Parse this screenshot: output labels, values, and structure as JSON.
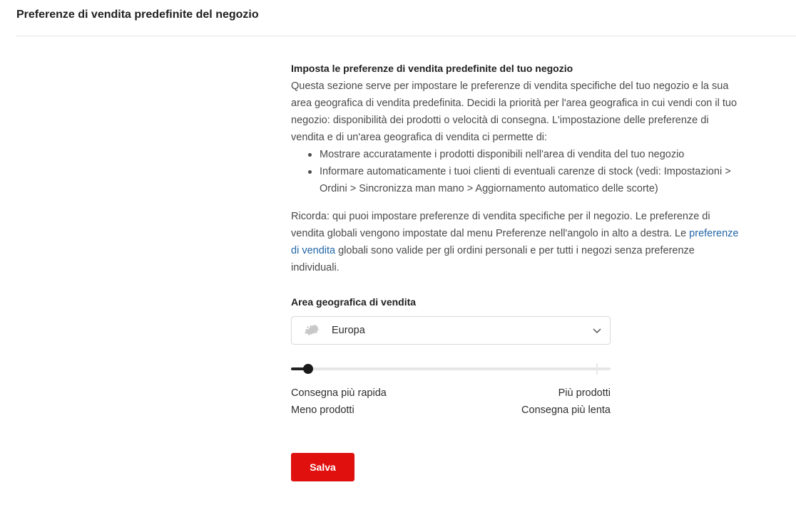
{
  "header": {
    "title": "Preferenze di vendita predefinite del negozio"
  },
  "intro": {
    "heading": "Imposta le preferenze di vendita predefinite del tuo negozio",
    "paragraph": "Questa sezione serve per impostare le preferenze di vendita specifiche del tuo negozio e la sua area geografica di vendita predefinita. Decidi la priorità per l'area geografica in cui vendi con il tuo negozio: disponibilità dei prodotti o velocità di consegna. L'impostazione delle preferenze di vendita e di un'area geografica di vendita ci permette di:",
    "bullets": [
      "Mostrare accuratamente i prodotti disponibili nell'area di vendita del tuo negozio",
      "Informare automaticamente i tuoi clienti di eventuali carenze di stock (vedi: Impostazioni > Ordini > Sincronizza man mano > Aggiornamento automatico delle scorte)"
    ],
    "reminder_before": "Ricorda: qui puoi impostare preferenze di vendita specifiche per il negozio. Le preferenze di vendita globali vengono impostate dal menu Preferenze nell'angolo in alto a destra. Le ",
    "reminder_link": "preferenze di vendita",
    "reminder_after": " globali sono valide per gli ordini personali e per tutti i negozi senza preferenze individuali."
  },
  "area": {
    "heading": "Area geografica di vendita",
    "selected": "Europa",
    "icon": "europe-map-icon"
  },
  "slider": {
    "value": 0.04,
    "left_top": "Consegna più rapida",
    "left_bottom": "Meno prodotti",
    "right_top": "Più prodotti",
    "right_bottom": "Consegna più lenta"
  },
  "actions": {
    "save_label": "Salva",
    "save_color": "#e0100f"
  },
  "colors": {
    "link": "#2366a8",
    "text": "#4a4a4a"
  }
}
